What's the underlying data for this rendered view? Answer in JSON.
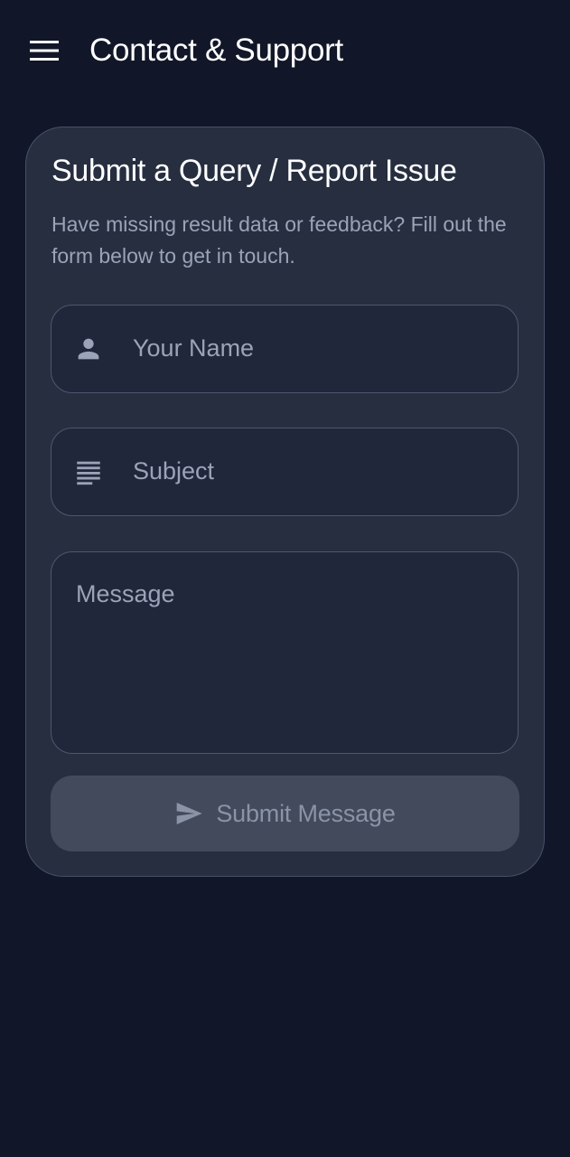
{
  "app_bar": {
    "title": "Contact & Support",
    "menu_icon": "menu-icon"
  },
  "form": {
    "title": "Submit a Query / Report Issue",
    "description": "Have missing result data or feedback? Fill out the form below to get in touch.",
    "name_field": {
      "placeholder": "Your Name",
      "icon": "person-icon"
    },
    "subject_field": {
      "placeholder": "Subject",
      "icon": "subject-lines-icon"
    },
    "message_field": {
      "placeholder": "Message"
    },
    "submit": {
      "label": "Submit Message",
      "icon": "send-icon"
    }
  },
  "colors": {
    "background": "#111628",
    "card": "#262e40",
    "field": "#20273a",
    "button_disabled": "#424a5c",
    "muted_text": "#9aa3b8"
  }
}
